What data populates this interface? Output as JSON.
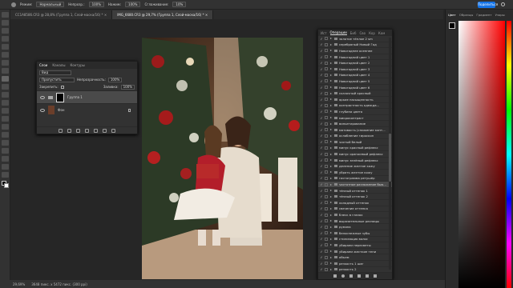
{
  "options_bar": {
    "mode_label": "Режим:",
    "mode_value": "Нормальный",
    "opacity_label": "Непрозр.:",
    "opacity_value": "100%",
    "pressure_label": "Нажим:",
    "pressure_value": "100%",
    "smoothing_label": "Сглаживание:",
    "smoothing_value": "10%",
    "share_button": "Поделиться"
  },
  "doc_tabs": [
    {
      "label": "CC1A8586.CR3 @ 28,8% (Группа 1, Слой-маска/16) *"
    },
    {
      "label": "IMG_6680.CR3 @ 29,7% (Группа 1, Слой-маска/16) *"
    }
  ],
  "layers_panel": {
    "tabs": [
      "Слои",
      "Каналы",
      "Контуры"
    ],
    "filter_label": "Вид",
    "blend_mode": "Пропустить",
    "opacity_label": "Непрозрачность:",
    "opacity_value": "100%",
    "lock_label": "Закрепить:",
    "fill_label": "Заливка:",
    "fill_value": "100%",
    "layers": [
      {
        "name": "Группа 1",
        "selected": true
      },
      {
        "name": "Фон",
        "selected": false
      }
    ]
  },
  "actions_panel": {
    "tabs": [
      "Ист",
      "Операции",
      "Биб",
      "Сво",
      "Кор",
      "Ком"
    ],
    "active_tab": "Операции",
    "items": [
      "золотое тёплое 2 sm",
      "серебряный Новый Год",
      "Новогоднее осеннее",
      "Новогодний цвет 1",
      "Новогодний цвет 2",
      "Новогодний цвет 3",
      "Новогодний цвет 4",
      "Новогодний цвет 5",
      "Новогодний цвет 6",
      "сказочный красный",
      "яркие насыщенность",
      "контрастность одежда...",
      "глубина цвета",
      "микроконтраст",
      "виньетирование",
      "матовость (снижение конт...",
      "ослабление гироскоп",
      "чистый белый",
      "минус красный рефлекс",
      "минус оранжевый рефлекс",
      "минус зелёный рефлекс",
      "деление желтое кожу",
      "убрать желтое кожу",
      "гистограмма ретушёр",
      "частотное разложение бью...",
      "тёплый оттенок 1",
      "тёплый оттенок 2",
      "холодный оттенок",
      "свечение оттенка",
      "блеск в глазах",
      "выразительные ресницы",
      "румяна",
      "белоснежные зубы",
      "стилизация волос",
      "убираем пересветы",
      "убираем жесткие тени",
      "объем",
      "резкость 1 шаг",
      "резкость 2",
      "резкость 3",
      "сохранение веб"
    ],
    "selected_index": 24
  },
  "status_bar": {
    "zoom": "29,69%",
    "doc_info": "3648 пикс. x 5472 пикс. (300 ppi)"
  },
  "color_panel": {
    "tabs": [
      "Цвет",
      "Образцы",
      "Градиент",
      "Узоры"
    ]
  },
  "colors": {
    "accent": "#1473e6",
    "panel_bg": "#323232",
    "app_bg": "#262626"
  }
}
